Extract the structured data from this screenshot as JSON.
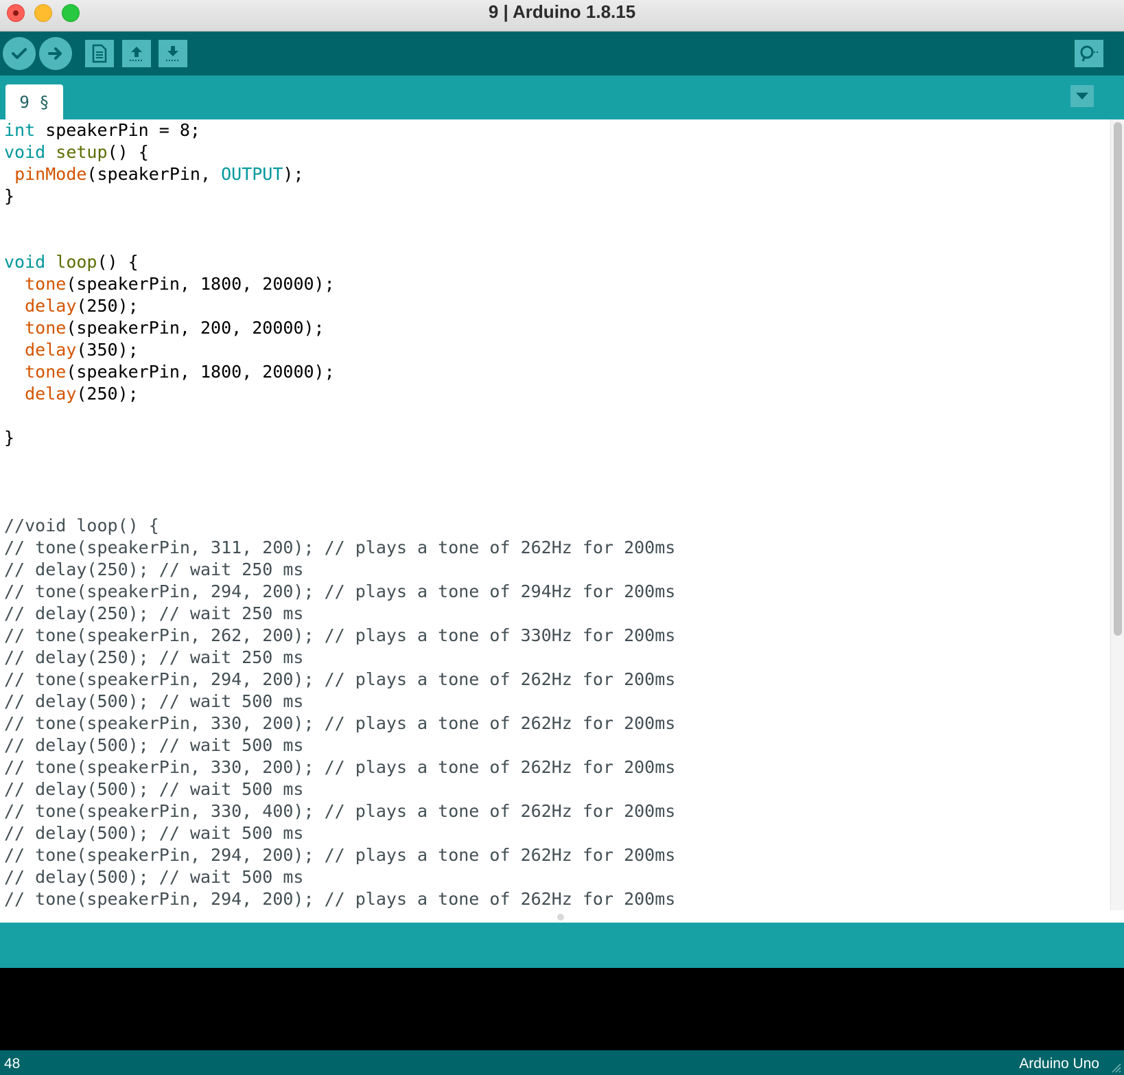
{
  "window": {
    "title": "9 | Arduino 1.8.15"
  },
  "toolbar": {
    "buttons": [
      {
        "name": "verify",
        "icon": "checkmark-icon"
      },
      {
        "name": "upload",
        "icon": "arrow-right-icon"
      },
      {
        "name": "new",
        "icon": "document-icon"
      },
      {
        "name": "open",
        "icon": "arrow-up-icon"
      },
      {
        "name": "save",
        "icon": "arrow-down-icon"
      },
      {
        "name": "serial-monitor",
        "icon": "magnifier-icon"
      }
    ]
  },
  "tabs": [
    {
      "label": "9 §",
      "active": true
    }
  ],
  "editor": {
    "lines": [
      [
        [
          "type",
          "int"
        ],
        [
          "plain",
          " speakerPin = 8;"
        ]
      ],
      [
        [
          "type",
          "void"
        ],
        [
          "plain",
          " "
        ],
        [
          "fn",
          "setup"
        ],
        [
          "plain",
          "() {"
        ]
      ],
      [
        [
          "plain",
          " "
        ],
        [
          "lib",
          "pinMode"
        ],
        [
          "plain",
          "(speakerPin, "
        ],
        [
          "const",
          "OUTPUT"
        ],
        [
          "plain",
          ");"
        ]
      ],
      [
        [
          "plain",
          "}"
        ]
      ],
      [
        [
          "plain",
          ""
        ]
      ],
      [
        [
          "plain",
          ""
        ]
      ],
      [
        [
          "type",
          "void"
        ],
        [
          "plain",
          " "
        ],
        [
          "fn",
          "loop"
        ],
        [
          "plain",
          "() {"
        ]
      ],
      [
        [
          "plain",
          "  "
        ],
        [
          "lib",
          "tone"
        ],
        [
          "plain",
          "(speakerPin, 1800, 20000);"
        ]
      ],
      [
        [
          "plain",
          "  "
        ],
        [
          "lib",
          "delay"
        ],
        [
          "plain",
          "(250);"
        ]
      ],
      [
        [
          "plain",
          "  "
        ],
        [
          "lib",
          "tone"
        ],
        [
          "plain",
          "(speakerPin, 200, 20000);"
        ]
      ],
      [
        [
          "plain",
          "  "
        ],
        [
          "lib",
          "delay"
        ],
        [
          "plain",
          "(350);"
        ]
      ],
      [
        [
          "plain",
          "  "
        ],
        [
          "lib",
          "tone"
        ],
        [
          "plain",
          "(speakerPin, 1800, 20000);"
        ]
      ],
      [
        [
          "plain",
          "  "
        ],
        [
          "lib",
          "delay"
        ],
        [
          "plain",
          "(250);"
        ]
      ],
      [
        [
          "plain",
          ""
        ]
      ],
      [
        [
          "plain",
          "}"
        ]
      ],
      [
        [
          "plain",
          ""
        ]
      ],
      [
        [
          "plain",
          ""
        ]
      ],
      [
        [
          "plain",
          ""
        ]
      ],
      [
        [
          "cmt",
          "//void loop() {"
        ]
      ],
      [
        [
          "cmt",
          "// tone(speakerPin, 311, 200); // plays a tone of 262Hz for 200ms"
        ]
      ],
      [
        [
          "cmt",
          "// delay(250); // wait 250 ms"
        ]
      ],
      [
        [
          "cmt",
          "// tone(speakerPin, 294, 200); // plays a tone of 294Hz for 200ms"
        ]
      ],
      [
        [
          "cmt",
          "// delay(250); // wait 250 ms"
        ]
      ],
      [
        [
          "cmt",
          "// tone(speakerPin, 262, 200); // plays a tone of 330Hz for 200ms"
        ]
      ],
      [
        [
          "cmt",
          "// delay(250); // wait 250 ms"
        ]
      ],
      [
        [
          "cmt",
          "// tone(speakerPin, 294, 200); // plays a tone of 262Hz for 200ms"
        ]
      ],
      [
        [
          "cmt",
          "// delay(500); // wait 500 ms"
        ]
      ],
      [
        [
          "cmt",
          "// tone(speakerPin, 330, 200); // plays a tone of 262Hz for 200ms"
        ]
      ],
      [
        [
          "cmt",
          "// delay(500); // wait 500 ms"
        ]
      ],
      [
        [
          "cmt",
          "// tone(speakerPin, 330, 200); // plays a tone of 262Hz for 200ms"
        ]
      ],
      [
        [
          "cmt",
          "// delay(500); // wait 500 ms"
        ]
      ],
      [
        [
          "cmt",
          "// tone(speakerPin, 330, 400); // plays a tone of 262Hz for 200ms"
        ]
      ],
      [
        [
          "cmt",
          "// delay(500); // wait 500 ms"
        ]
      ],
      [
        [
          "cmt",
          "// tone(speakerPin, 294, 200); // plays a tone of 262Hz for 200ms"
        ]
      ],
      [
        [
          "cmt",
          "// delay(500); // wait 500 ms"
        ]
      ],
      [
        [
          "cmt",
          "// tone(speakerPin, 294, 200); // plays a tone of 262Hz for 200ms"
        ]
      ]
    ]
  },
  "footer": {
    "line_number": "48",
    "board": "Arduino Uno"
  },
  "colors": {
    "toolbar_bg": "#006468",
    "tabstrip_bg": "#17a1a5",
    "button_bg": "#4db7bb",
    "keyword_type": "#00979c",
    "keyword_function": "#5e6d03",
    "library_function": "#d35400",
    "comment": "#434f54"
  }
}
